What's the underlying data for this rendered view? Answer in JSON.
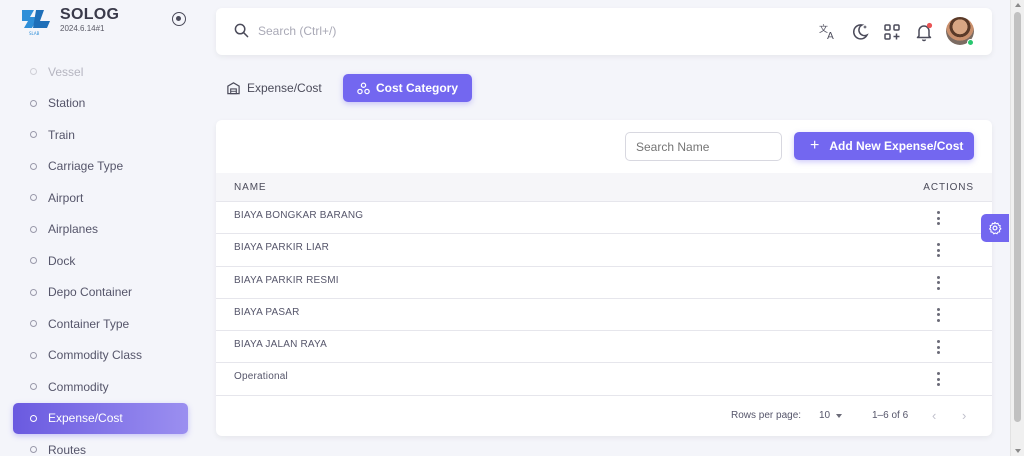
{
  "brand": {
    "name": "SOLOG",
    "version": "2024.6.14#1",
    "logo_text": "SL"
  },
  "sidebar": {
    "items": [
      {
        "label": "Vessel",
        "state": "faded"
      },
      {
        "label": "Station",
        "state": ""
      },
      {
        "label": "Train",
        "state": ""
      },
      {
        "label": "Carriage Type",
        "state": ""
      },
      {
        "label": "Airport",
        "state": ""
      },
      {
        "label": "Airplanes",
        "state": ""
      },
      {
        "label": "Dock",
        "state": ""
      },
      {
        "label": "Depo Container",
        "state": ""
      },
      {
        "label": "Container Type",
        "state": ""
      },
      {
        "label": "Commodity Class",
        "state": ""
      },
      {
        "label": "Commodity",
        "state": ""
      },
      {
        "label": "Expense/Cost",
        "state": "active"
      },
      {
        "label": "Routes",
        "state": ""
      }
    ]
  },
  "topbar": {
    "search_placeholder": "Search (Ctrl+/)",
    "icons": [
      "translate-icon",
      "dark-mode-icon",
      "shortcuts-icon",
      "notifications-icon"
    ]
  },
  "tabs": [
    {
      "label": "Expense/Cost",
      "active": false
    },
    {
      "label": "Cost Category",
      "active": true
    }
  ],
  "toolbar": {
    "search_placeholder": "Search Name",
    "add_label": "Add New Expense/Cost"
  },
  "table": {
    "columns": [
      "NAME",
      "ACTIONS"
    ],
    "rows": [
      "BIAYA BONGKAR BARANG",
      "BIAYA PARKIR LIAR",
      "BIAYA PARKIR RESMI",
      "BIAYA PASAR",
      "BIAYA JALAN RAYA",
      "Operational"
    ]
  },
  "pagination": {
    "rows_per_page_label": "Rows per page:",
    "rows_per_page": "10",
    "range": "1–6 of 6"
  },
  "colors": {
    "primary": "#7367f0",
    "online": "#28c76f",
    "badge": "#ea5455",
    "logo": "#2f8fd8"
  }
}
